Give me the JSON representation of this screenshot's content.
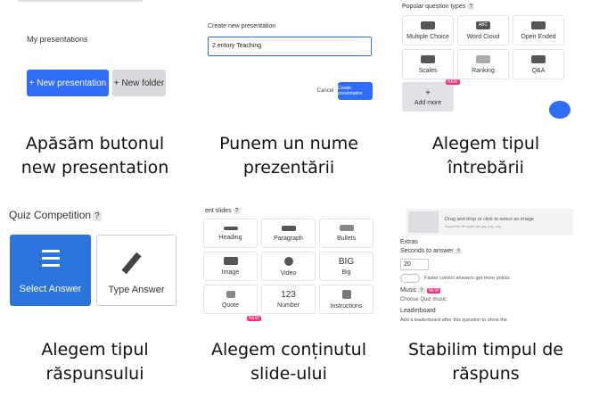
{
  "panel1": {
    "title": "My presentations",
    "new_presentation": "+ New presentation",
    "new_folder": "+ New folder"
  },
  "panel2": {
    "label": "Create new presentation",
    "input_value": "2  entury Teaching",
    "cancel": "Cancel",
    "create": "Create presentation"
  },
  "panel3": {
    "title": "Popular question types",
    "help": "?",
    "tiles": [
      "Multiple Choice",
      "Word Cloud",
      "Open Ended",
      "Scales",
      "Ranking",
      "Q&A",
      "Add more"
    ],
    "badge": "NEW",
    "word_cloud_icon": "ABC"
  },
  "panel4": {
    "title": "Quiz Competition",
    "help": "?",
    "select_answer": "Select Answer",
    "type_answer": "Type Answer"
  },
  "panel5": {
    "title": "ent slides",
    "help": "?",
    "tiles": [
      "Heading",
      "Paragraph",
      "Bullets",
      "Image",
      "Video",
      "Big",
      "Quote",
      "Number",
      "Instructions"
    ],
    "big_icon": "BIG",
    "number_icon": "123",
    "badge": "NEW"
  },
  "panel6": {
    "drop_text": "Drag and drop or click to select an image",
    "drop_sub": "Supported file types are jpg, png, svg",
    "extras": "Extras",
    "seconds_label": "Seconds to answer",
    "help": "?",
    "seconds_value": "20",
    "faster_text": "Faster correct answers get more points.",
    "music": "Music",
    "badge": "NEW",
    "choose_music": "Choose Quiz music",
    "leaderboard": "Leaderboard",
    "leaderboard_text": "Add a leaderboard after this question to show the"
  },
  "captions": {
    "c1": [
      "Apăsăm butonul",
      "new presentation"
    ],
    "c2": [
      "Punem un nume",
      "prezentării"
    ],
    "c3": [
      "Alegem tipul",
      "întrebării"
    ],
    "c4": [
      "Alegem tipul",
      "răspunsului"
    ],
    "c5": [
      "Alegem conținutul",
      "slide-ului"
    ],
    "c6": [
      "Stabilim timpul de",
      "răspuns"
    ]
  },
  "colors": {
    "accent": "#2f6df6",
    "select_blue": "#2b74dc",
    "badge_pink": "#ff2d74"
  }
}
